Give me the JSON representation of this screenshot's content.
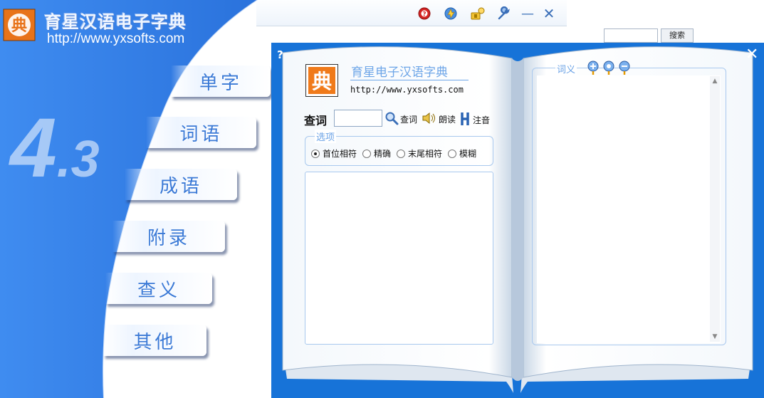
{
  "background_window": {
    "search_button_label": "搜索"
  },
  "titlebar": {
    "icons": [
      "help-icon",
      "refresh-icon",
      "key-icon",
      "wrench-icon",
      "minimize-icon",
      "close-icon"
    ],
    "minimize_glyph": "—",
    "close_glyph": "✕"
  },
  "brand": {
    "title": "育星汉语电子字典",
    "url": "http://www.yxsofts.com",
    "version_major": "4",
    "version_minor": ".3",
    "logo_glyph": "典"
  },
  "tabs": [
    {
      "label": "单字"
    },
    {
      "label": "词语"
    },
    {
      "label": "成语"
    },
    {
      "label": "附录"
    },
    {
      "label": "查义"
    },
    {
      "label": "其他"
    }
  ],
  "dialog": {
    "help_glyph": "?",
    "close_glyph": "✕",
    "logo_glyph": "典",
    "title": "育星电子汉语字典",
    "url": "http://www.yxsofts.com",
    "query_label": "查词",
    "query_value": "",
    "lookup_label": "查词",
    "read_label": "朗读",
    "phonetic_label": "注音",
    "options": {
      "legend": "选项",
      "items": [
        {
          "label": "首位相符",
          "checked": true
        },
        {
          "label": "精确",
          "checked": false
        },
        {
          "label": "末尾相符",
          "checked": false
        },
        {
          "label": "模糊",
          "checked": false
        }
      ]
    },
    "meaning": {
      "legend": "词义"
    }
  },
  "colors": {
    "panel_blue": "#2f7de6",
    "dialog_blue": "#1773d8",
    "tab_text": "#3a79d6",
    "legend_text": "#6aa2e6"
  }
}
